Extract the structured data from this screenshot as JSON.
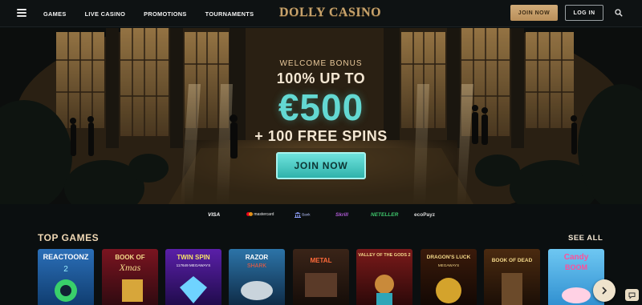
{
  "header": {
    "nav": [
      "GAMES",
      "LIVE CASINO",
      "PROMOTIONS",
      "TOURNAMENTS"
    ],
    "logo": "DOLLY CASINO",
    "join_label": "JOIN NOW",
    "login_label": "LOG IN",
    "icons": {
      "menu": "hamburger-menu-icon",
      "search": "search-icon"
    }
  },
  "hero": {
    "welcome": "WELCOME BONUS",
    "percent": "100% UP TO",
    "amount": "€500",
    "spins": "+ 100 FREE SPINS",
    "cta": "JOIN NOW"
  },
  "payments": [
    "VISA",
    "mastercard",
    "Bank",
    "Skrill",
    "NETELLER",
    "ecoPayz"
  ],
  "top_games": {
    "title": "TOP GAMES",
    "see_all": "SEE ALL",
    "games": [
      {
        "title": "REACTOONZ",
        "subtitle": "2"
      },
      {
        "title": "BOOK OF",
        "subtitle": "Xmas"
      },
      {
        "title": "TWIN SPIN",
        "subtitle": "117649 MEGAWAYS"
      },
      {
        "title": "RAZOR",
        "subtitle": "SHARK"
      },
      {
        "title": "METAL",
        "subtitle": ""
      },
      {
        "title": "VALLEY OF THE GODS 2",
        "subtitle": ""
      },
      {
        "title": "DRAGON'S LUCK",
        "subtitle": "MEGAWAYS"
      },
      {
        "title": "BOOK OF DEAD",
        "subtitle": ""
      },
      {
        "title": "Candy",
        "subtitle": "BOOM"
      }
    ]
  },
  "colors": {
    "accent_gold": "#c7a26b",
    "accent_teal": "#4fd0c9",
    "background": "#0b0f10"
  }
}
